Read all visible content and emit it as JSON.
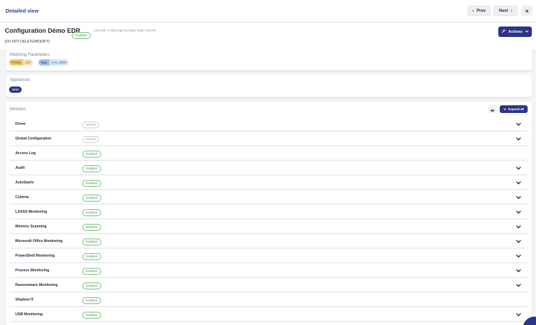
{
  "topbar": {
    "title": "Detailed view",
    "prev_label": "Prev",
    "next_label": "Next"
  },
  "config": {
    "name": "Configuration Démo EDR",
    "status": "Enabled",
    "meta": "Last edit : 3 days ago by Maya Sapo Laurent",
    "description": "[DO NOT DELETE/MODIFY]",
    "actions_label": "Actions"
  },
  "matching": {
    "title": "Matching Parameters",
    "priority_key": "Priority",
    "priority_value": "120",
    "tags_key": "Tags",
    "tags_value": "AAA_DEM"
  },
  "appliances": {
    "title": "Appliances",
    "items": [
      "SEM"
    ]
  },
  "modules": {
    "title": "Modules",
    "expand_label": "Expand all",
    "items": [
      {
        "name": "Driver",
        "status": "Default"
      },
      {
        "name": "Global Configuration",
        "status": "Default"
      },
      {
        "name": "Access Log",
        "status": "Enabled"
      },
      {
        "name": "Audit",
        "status": "Enabled"
      },
      {
        "name": "AutoStarts",
        "status": "Enabled"
      },
      {
        "name": "Cyberia",
        "status": "Enabled"
      },
      {
        "name": "LSASS Monitoring",
        "status": "Enabled"
      },
      {
        "name": "Memory Scanning",
        "status": "Enabled"
      },
      {
        "name": "Microsoft Office Monitoring",
        "status": "Enabled"
      },
      {
        "name": "PowerShell Monitoring",
        "status": "Enabled"
      },
      {
        "name": "Process Monitoring",
        "status": "Enabled"
      },
      {
        "name": "Ransomware Monitoring",
        "status": "Enabled"
      },
      {
        "name": "Shadow IT",
        "status": "Enabled"
      },
      {
        "name": "USB Monitoring",
        "status": "Enabled"
      }
    ]
  },
  "colors": {
    "primary": "#2b3488",
    "enabled": "#4a9a52",
    "default": "#9ca0a8",
    "priority_chip": "#f2c86a",
    "tags_chip": "#9fc2e8"
  }
}
